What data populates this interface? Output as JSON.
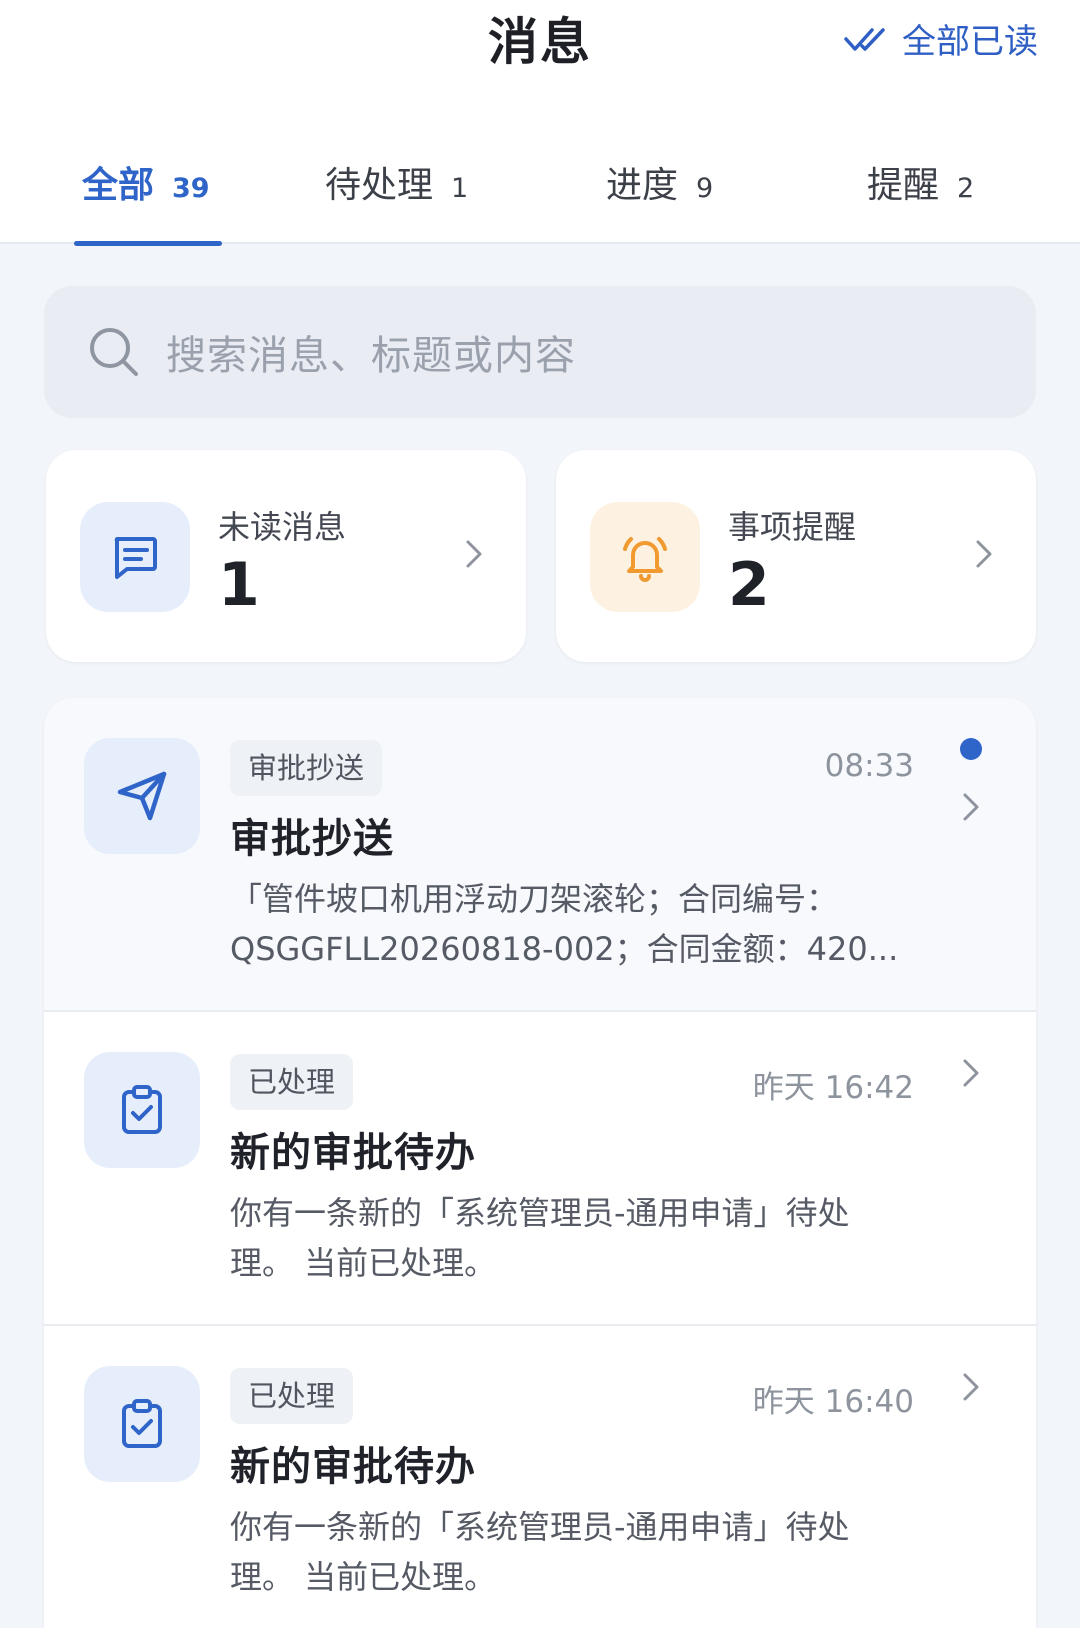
{
  "header": {
    "title": "消息",
    "read_all_label": "全部已读"
  },
  "tabs": [
    {
      "label": "全部",
      "count": "39",
      "active": true
    },
    {
      "label": "待处理",
      "count": "1",
      "active": false
    },
    {
      "label": "进度",
      "count": "9",
      "active": false
    },
    {
      "label": "提醒",
      "count": "2",
      "active": false
    }
  ],
  "search": {
    "placeholder": "搜索消息、标题或内容"
  },
  "stats": {
    "unread": {
      "label": "未读消息",
      "value": "1",
      "icon": "message-icon",
      "color": "#2f64c8"
    },
    "reminder": {
      "label": "事项提醒",
      "value": "2",
      "icon": "bell-icon",
      "color": "#f09a30"
    }
  },
  "messages": [
    {
      "tag": "审批抄送",
      "time": "08:33",
      "title": "审批抄送",
      "body_line1": "「管件坡口机用浮动刀架滚轮；合同编号：",
      "body_line2": "QSGGFLL20260818-002；合同金额：420...",
      "unread": true,
      "icon": "send-icon"
    },
    {
      "tag": "已处理",
      "time": "昨天 16:42",
      "title": "新的审批待办",
      "body_line1": "你有一条新的「系统管理员-通用申请」待处",
      "body_line2": "理。 当前已处理。",
      "unread": false,
      "icon": "clipboard-check-icon"
    },
    {
      "tag": "已处理",
      "time": "昨天 16:40",
      "title": "新的审批待办",
      "body_line1": "你有一条新的「系统管理员-通用申请」待处",
      "body_line2": "理。 当前已处理。",
      "unread": false,
      "icon": "clipboard-check-icon"
    }
  ],
  "colors": {
    "accent": "#2f64c8",
    "background": "#f2f5fa",
    "unread_dot": "#2f64c8"
  }
}
